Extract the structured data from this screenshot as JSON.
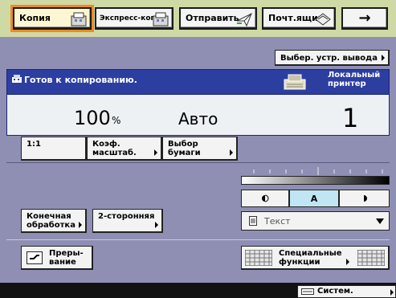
{
  "tabs": [
    {
      "label": "Копия",
      "active": true
    },
    {
      "label": "Экспресс-коп."
    },
    {
      "label": "Отправить"
    },
    {
      "label": "Почт.ящик"
    }
  ],
  "arrow_tab": "→",
  "output_device_label": "Выбер. устр. вывода",
  "status": {
    "text": "Готов к копированию.",
    "printer_line1": "Локальный",
    "printer_line2": "принтер"
  },
  "values": {
    "ratio": "100",
    "ratio_unit": "%",
    "paper": "Авто",
    "count": "1"
  },
  "buttons": {
    "one_to_one": "1:1",
    "scale_line1": "Коэф.",
    "scale_line2": "масштаб.",
    "paper_line1": "Выбор",
    "paper_line2": "бумаги",
    "finishing_line1": "Конечная",
    "finishing_line2": "обработка",
    "duplex": "2-сторонняя",
    "interrupt_line1": "Преры-",
    "interrupt_line2": "вание",
    "special_line1": "Специальные",
    "special_line2": "функции"
  },
  "density": {
    "auto": "A",
    "original_type": "Текст"
  },
  "system_monitor": "Систем. монитор",
  "colors": {
    "accent": "#f08a1e",
    "status_blue": "#2c3ea0",
    "panel": "#8f8fb4",
    "topbar": "#cfd9a6"
  }
}
